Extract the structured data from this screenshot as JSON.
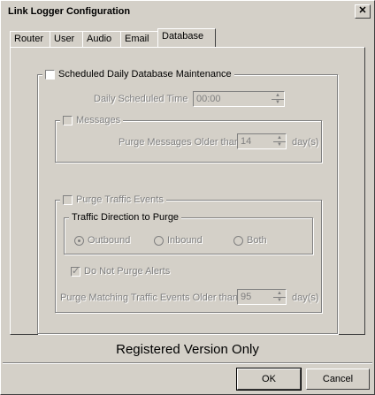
{
  "window": {
    "title": "Link Logger Configuration",
    "close_glyph": "✕"
  },
  "tabs": [
    {
      "label": "Router"
    },
    {
      "label": "User"
    },
    {
      "label": "Audio"
    },
    {
      "label": "Email"
    },
    {
      "label": "Database"
    }
  ],
  "maintenance": {
    "checkbox_label": "Scheduled Daily Database Maintenance",
    "time_label": "Daily Scheduled Time",
    "time_value": "00:00"
  },
  "messages": {
    "checkbox_label": "Messages",
    "purge_label": "Purge Messages Older than",
    "purge_value": "14",
    "unit": "day(s)"
  },
  "traffic": {
    "checkbox_label": "Purge Traffic Events",
    "direction_title": "Traffic Direction to Purge",
    "options": [
      "Outbound",
      "Inbound",
      "Both"
    ],
    "selected": "Outbound",
    "alerts_label": "Do Not Purge Alerts",
    "alerts_checked": true,
    "purge_label": "Purge Matching Traffic Events Older than",
    "purge_value": "95",
    "unit": "day(s)"
  },
  "registered_text": "Registered Version Only",
  "buttons": {
    "ok": "OK",
    "cancel": "Cancel"
  }
}
